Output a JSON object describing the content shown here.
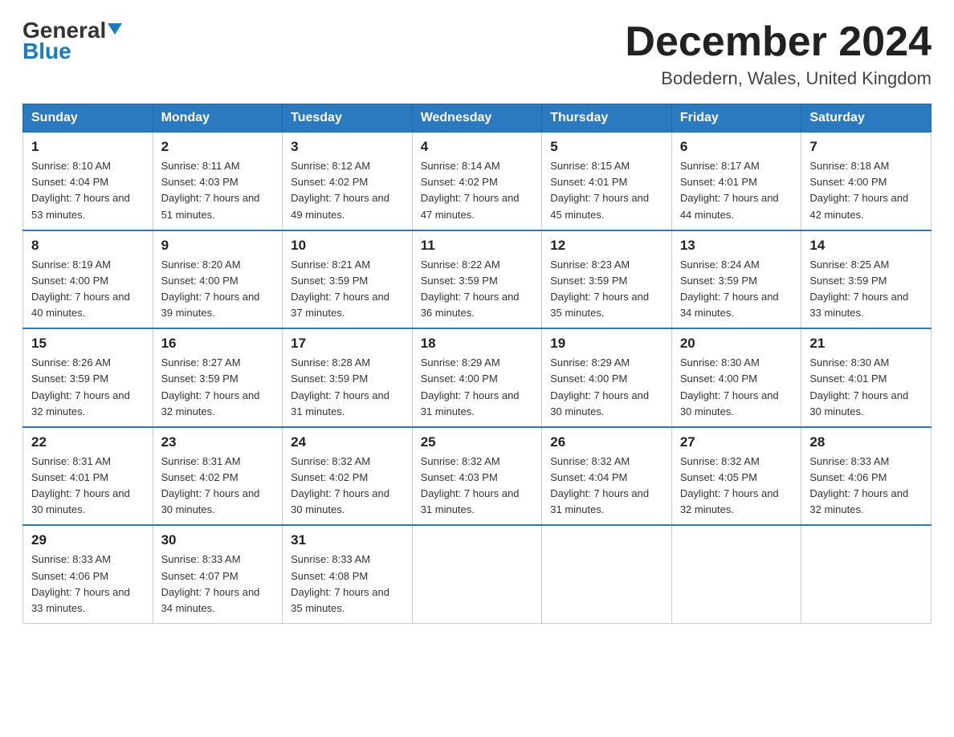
{
  "header": {
    "logo_general": "General",
    "logo_blue": "Blue",
    "month_title": "December 2024",
    "location": "Bodedern, Wales, United Kingdom"
  },
  "days_of_week": [
    "Sunday",
    "Monday",
    "Tuesday",
    "Wednesday",
    "Thursday",
    "Friday",
    "Saturday"
  ],
  "weeks": [
    [
      {
        "day": "1",
        "sunrise": "8:10 AM",
        "sunset": "4:04 PM",
        "daylight": "7 hours and 53 minutes."
      },
      {
        "day": "2",
        "sunrise": "8:11 AM",
        "sunset": "4:03 PM",
        "daylight": "7 hours and 51 minutes."
      },
      {
        "day": "3",
        "sunrise": "8:12 AM",
        "sunset": "4:02 PM",
        "daylight": "7 hours and 49 minutes."
      },
      {
        "day": "4",
        "sunrise": "8:14 AM",
        "sunset": "4:02 PM",
        "daylight": "7 hours and 47 minutes."
      },
      {
        "day": "5",
        "sunrise": "8:15 AM",
        "sunset": "4:01 PM",
        "daylight": "7 hours and 45 minutes."
      },
      {
        "day": "6",
        "sunrise": "8:17 AM",
        "sunset": "4:01 PM",
        "daylight": "7 hours and 44 minutes."
      },
      {
        "day": "7",
        "sunrise": "8:18 AM",
        "sunset": "4:00 PM",
        "daylight": "7 hours and 42 minutes."
      }
    ],
    [
      {
        "day": "8",
        "sunrise": "8:19 AM",
        "sunset": "4:00 PM",
        "daylight": "7 hours and 40 minutes."
      },
      {
        "day": "9",
        "sunrise": "8:20 AM",
        "sunset": "4:00 PM",
        "daylight": "7 hours and 39 minutes."
      },
      {
        "day": "10",
        "sunrise": "8:21 AM",
        "sunset": "3:59 PM",
        "daylight": "7 hours and 37 minutes."
      },
      {
        "day": "11",
        "sunrise": "8:22 AM",
        "sunset": "3:59 PM",
        "daylight": "7 hours and 36 minutes."
      },
      {
        "day": "12",
        "sunrise": "8:23 AM",
        "sunset": "3:59 PM",
        "daylight": "7 hours and 35 minutes."
      },
      {
        "day": "13",
        "sunrise": "8:24 AM",
        "sunset": "3:59 PM",
        "daylight": "7 hours and 34 minutes."
      },
      {
        "day": "14",
        "sunrise": "8:25 AM",
        "sunset": "3:59 PM",
        "daylight": "7 hours and 33 minutes."
      }
    ],
    [
      {
        "day": "15",
        "sunrise": "8:26 AM",
        "sunset": "3:59 PM",
        "daylight": "7 hours and 32 minutes."
      },
      {
        "day": "16",
        "sunrise": "8:27 AM",
        "sunset": "3:59 PM",
        "daylight": "7 hours and 32 minutes."
      },
      {
        "day": "17",
        "sunrise": "8:28 AM",
        "sunset": "3:59 PM",
        "daylight": "7 hours and 31 minutes."
      },
      {
        "day": "18",
        "sunrise": "8:29 AM",
        "sunset": "4:00 PM",
        "daylight": "7 hours and 31 minutes."
      },
      {
        "day": "19",
        "sunrise": "8:29 AM",
        "sunset": "4:00 PM",
        "daylight": "7 hours and 30 minutes."
      },
      {
        "day": "20",
        "sunrise": "8:30 AM",
        "sunset": "4:00 PM",
        "daylight": "7 hours and 30 minutes."
      },
      {
        "day": "21",
        "sunrise": "8:30 AM",
        "sunset": "4:01 PM",
        "daylight": "7 hours and 30 minutes."
      }
    ],
    [
      {
        "day": "22",
        "sunrise": "8:31 AM",
        "sunset": "4:01 PM",
        "daylight": "7 hours and 30 minutes."
      },
      {
        "day": "23",
        "sunrise": "8:31 AM",
        "sunset": "4:02 PM",
        "daylight": "7 hours and 30 minutes."
      },
      {
        "day": "24",
        "sunrise": "8:32 AM",
        "sunset": "4:02 PM",
        "daylight": "7 hours and 30 minutes."
      },
      {
        "day": "25",
        "sunrise": "8:32 AM",
        "sunset": "4:03 PM",
        "daylight": "7 hours and 31 minutes."
      },
      {
        "day": "26",
        "sunrise": "8:32 AM",
        "sunset": "4:04 PM",
        "daylight": "7 hours and 31 minutes."
      },
      {
        "day": "27",
        "sunrise": "8:32 AM",
        "sunset": "4:05 PM",
        "daylight": "7 hours and 32 minutes."
      },
      {
        "day": "28",
        "sunrise": "8:33 AM",
        "sunset": "4:06 PM",
        "daylight": "7 hours and 32 minutes."
      }
    ],
    [
      {
        "day": "29",
        "sunrise": "8:33 AM",
        "sunset": "4:06 PM",
        "daylight": "7 hours and 33 minutes."
      },
      {
        "day": "30",
        "sunrise": "8:33 AM",
        "sunset": "4:07 PM",
        "daylight": "7 hours and 34 minutes."
      },
      {
        "day": "31",
        "sunrise": "8:33 AM",
        "sunset": "4:08 PM",
        "daylight": "7 hours and 35 minutes."
      },
      null,
      null,
      null,
      null
    ]
  ]
}
